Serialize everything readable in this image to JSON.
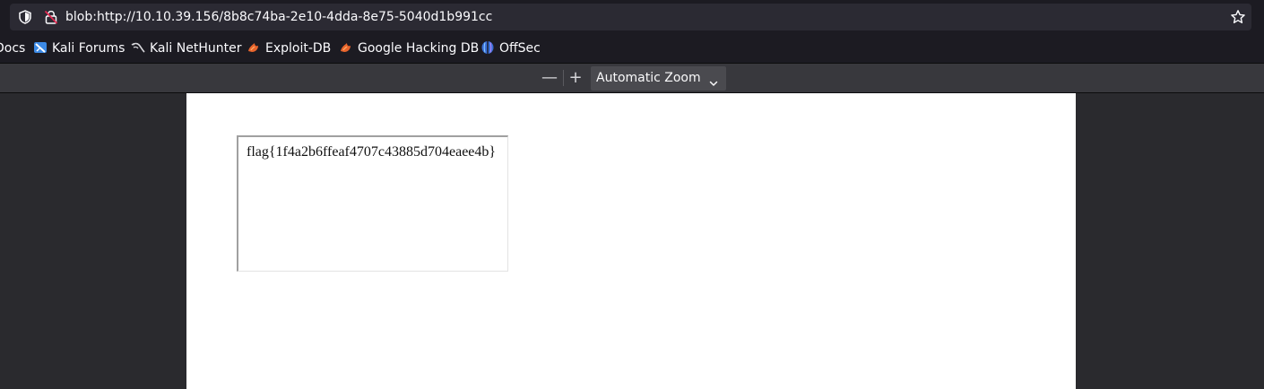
{
  "urlbar": {
    "url": "blob:http://10.10.39.156/8b8c74ba-2e10-4dda-8e75-5040d1b991cc"
  },
  "bookmarks": [
    {
      "label": "Docs",
      "icon": "none"
    },
    {
      "label": "Kali Forums",
      "icon": "kali-forums-icon"
    },
    {
      "label": "Kali NetHunter",
      "icon": "kali-dragon-icon"
    },
    {
      "label": "Exploit-DB",
      "icon": "exploit-db-icon"
    },
    {
      "label": "Google Hacking DB",
      "icon": "ghdb-icon"
    },
    {
      "label": "OffSec",
      "icon": "offsec-icon"
    }
  ],
  "pdf_toolbar": {
    "zoom_out": "—",
    "zoom_in": "+",
    "zoom_level": "Automatic Zoom"
  },
  "document": {
    "field_value": "flag{1f4a2b6ffeaf4707c43885d704eaee4b}"
  },
  "colors": {
    "chrome_bg": "#1c1b22",
    "urlbar_bg": "#2b2a33",
    "toolbar_bg": "#38383d",
    "viewer_bg": "#2a2a2e",
    "page_bg": "#ffffff",
    "exploit_orange": "#e8642c",
    "offsec_blue": "#3a6fd8"
  }
}
